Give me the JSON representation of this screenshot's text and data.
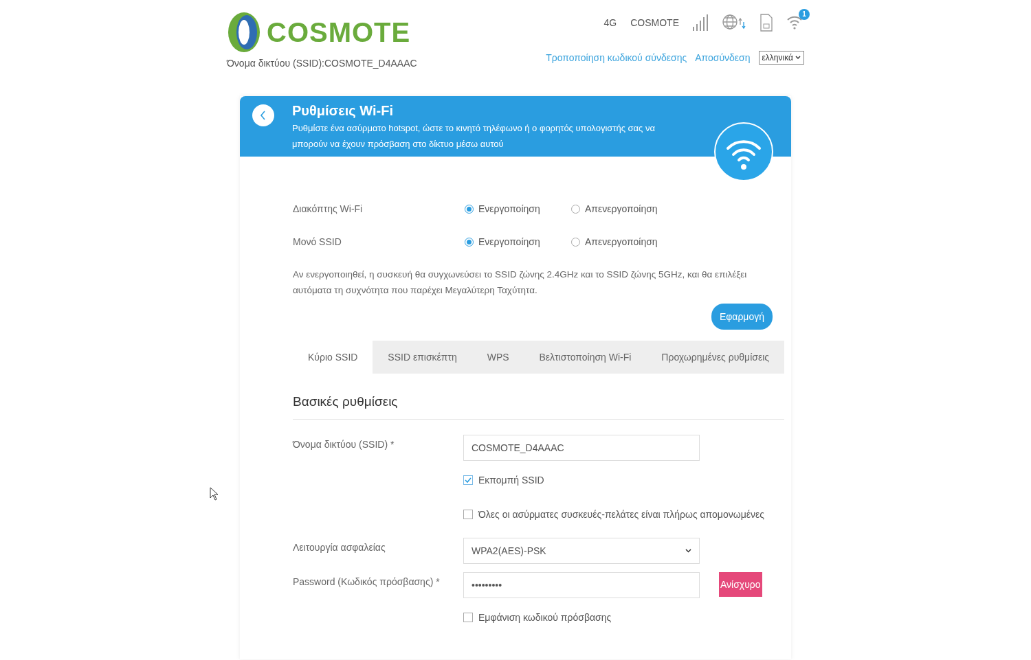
{
  "header": {
    "logo_text": "COSMOTE",
    "ssid_line": "Όνομα δικτύου (SSID):COSMOTE_D4AAAC",
    "status": {
      "network_type": "4G",
      "operator": "COSMOTE",
      "wifi_badge": "1"
    },
    "links": [
      "Τροποποίηση κωδικού σύνδεσης",
      "Αποσύνδεση"
    ],
    "language": "ελληνικά"
  },
  "banner": {
    "title": "Ρυθμίσεις Wi-Fi",
    "description": "Ρυθμίστε ένα ασύρματο hotspot, ώστε το κινητό τηλέφωνο ή ο φορητός υπολογιστής σας να μπορούν να έχουν πρόσβαση στο δίκτυο μέσω αυτού"
  },
  "radio_settings": [
    {
      "label": "Διακόπτης Wi-Fi",
      "options": [
        {
          "label": "Ενεργοποίηση",
          "selected": true
        },
        {
          "label": "Απενεργοποίηση",
          "selected": false
        }
      ]
    },
    {
      "label": "Μονό SSID",
      "options": [
        {
          "label": "Ενεργοποίηση",
          "selected": true
        },
        {
          "label": "Απενεργοποίηση",
          "selected": false
        }
      ]
    }
  ],
  "note": "Αν ενεργοποιηθεί, η συσκευή θα συγχωνεύσει το SSID ζώνης 2.4GHz και το SSID ζώνης 5GHz, και θα επιλέξει αυτόματα τη συχνότητα που παρέχει Μεγαλύτερη Ταχύτητα.",
  "apply_button": "Εφαρμογή",
  "tabs": [
    {
      "label": "Κύριο SSID",
      "selected": true
    },
    {
      "label": "SSID επισκέπτη",
      "selected": false
    },
    {
      "label": "WPS",
      "selected": false
    },
    {
      "label": "Βελτιστοποίηση Wi-Fi",
      "selected": false
    },
    {
      "label": "Προχωρημένες ρυθμίσεις",
      "selected": false
    }
  ],
  "section_title": "Βασικές ρυθμίσεις",
  "form": [
    {
      "kind": "text",
      "label": "Όνομα δικτύου (SSID) *",
      "value": "COSMOTE_D4AAAC"
    },
    {
      "kind": "checkbox",
      "label": "Εκπομπή SSID",
      "checked": true
    },
    {
      "kind": "checkbox",
      "label": "Όλες οι ασύρματες συσκευές-πελάτες είναι πλήρως απομονωμένες",
      "checked": false
    },
    {
      "kind": "select",
      "label": "Λειτουργία ασφαλείας",
      "value": "WPA2(AES)-PSK"
    },
    {
      "kind": "password",
      "label": "Password (Κωδικός πρόσβασης) *",
      "value": "•••••••••",
      "strength": "Ανίσχυρο"
    },
    {
      "kind": "checkbox",
      "label": "Εμφάνιση κωδικού πρόσβασης",
      "checked": false
    }
  ]
}
